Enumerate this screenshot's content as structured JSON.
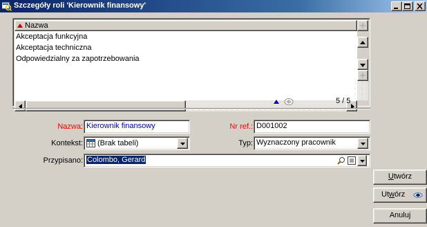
{
  "window": {
    "title": "Szczegóły roli 'Kierownik finansowy'"
  },
  "list": {
    "column_header": "Nazwa",
    "rows": [
      "Akceptacja funkcyjna",
      "Akceptacja techniczna",
      "Odpowiedzialny za zapotrzebowania"
    ],
    "pager": "5 / 5"
  },
  "form": {
    "name_label": "Nazwa:",
    "name_value": "Kierownik finansowy",
    "ref_label": "Nr ref.:",
    "ref_value": "D001002",
    "context_label": "Kontekst:",
    "context_value": "(Brak tabeli)",
    "type_label": "Typ:",
    "type_value": "Wyznaczony pracownik",
    "assigned_label": "Przypisano:",
    "assigned_value": "Colombo, Gerard"
  },
  "buttons": {
    "create": "Utwórz",
    "create_underline": "U",
    "create_rest": "twórz",
    "create_menu_u": "U",
    "create_menu_mid": "t",
    "create_menu_w": "w",
    "create_menu_rest": "órz",
    "cancel": "Anuluj"
  },
  "colors": {
    "titlebar_start": "#0a246a",
    "titlebar_end": "#a6caf0",
    "required_label": "#ff0000",
    "value_text": "#0000c8",
    "selection": "#0a246a",
    "face": "#d4d0c8"
  }
}
